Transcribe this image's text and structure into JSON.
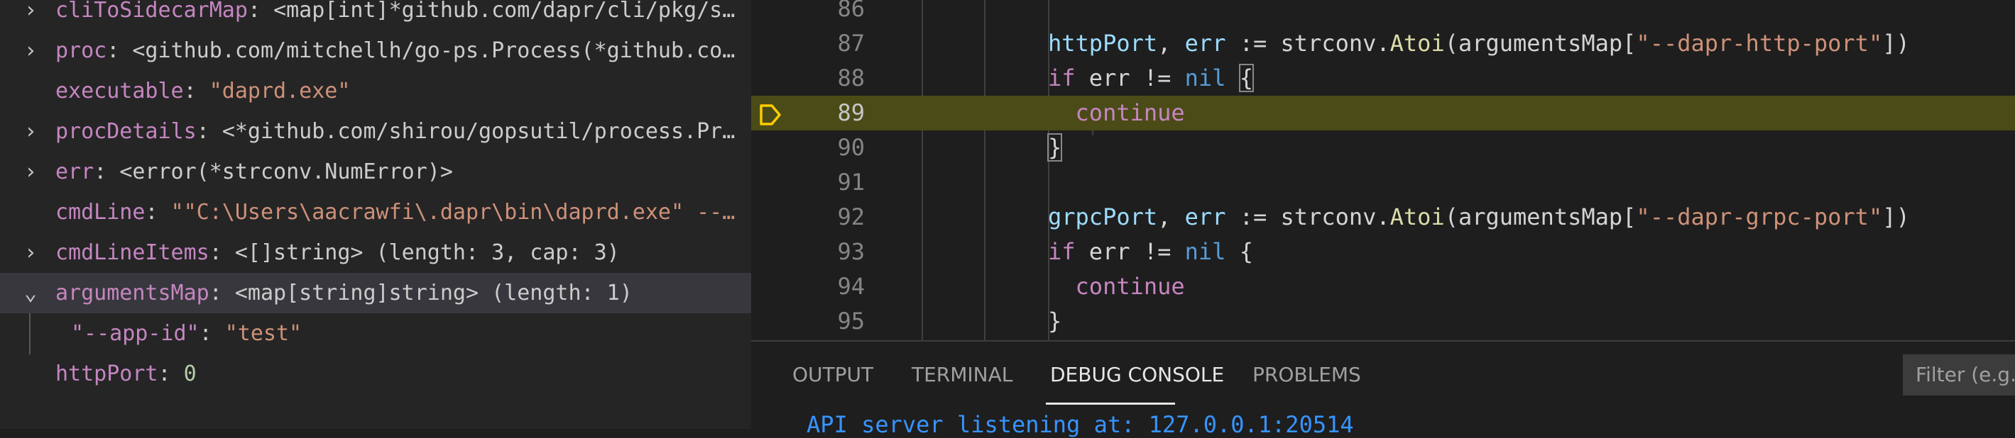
{
  "variables": [
    {
      "chevron": "›",
      "name": "cliToSidecarMap",
      "value": "<map[int]*github.com/dapr/cli/pkg/s…",
      "vtype": "val"
    },
    {
      "chevron": "›",
      "name": "proc",
      "value": "<github.com/mitchellh/go-ps.Process(*github.co…",
      "vtype": "val"
    },
    {
      "chevron": "",
      "name": "executable",
      "value": "\"daprd.exe\"",
      "vtype": "str"
    },
    {
      "chevron": "›",
      "name": "procDetails",
      "value": "<*github.com/shirou/gopsutil/process.Pr…",
      "vtype": "val"
    },
    {
      "chevron": "›",
      "name": "err",
      "value": "<error(*strconv.NumError)>",
      "vtype": "val"
    },
    {
      "chevron": "",
      "name": "cmdLine",
      "value": "\"\"C:\\Users\\aacrawfi\\.dapr\\bin\\daprd.exe\" --…",
      "vtype": "str"
    },
    {
      "chevron": "›",
      "name": "cmdLineItems",
      "value": "<[]string> (length: 3, cap: 3)",
      "vtype": "val"
    },
    {
      "chevron": "⌄",
      "name": "argumentsMap",
      "value": "<map[string]string> (length: 1)",
      "vtype": "val"
    },
    {
      "chevron": "",
      "name": "\"--app-id\"",
      "value": "\"test\"",
      "vtype": "str"
    },
    {
      "chevron": "",
      "name": "httpPort",
      "value": "0",
      "vtype": "num"
    }
  ],
  "editor": {
    "current_line": "89",
    "lines": [
      {
        "num": "86",
        "tokens": []
      },
      {
        "num": "87",
        "tokens": [
          [
            "var",
            "httpPort"
          ],
          [
            "op",
            ", "
          ],
          [
            "var",
            "err"
          ],
          [
            "op",
            " := strconv."
          ],
          [
            "fn",
            "Atoi"
          ],
          [
            "op",
            "(argumentsMap["
          ],
          [
            "str",
            "\"--dapr-http-port\""
          ],
          [
            "op",
            "])"
          ]
        ]
      },
      {
        "num": "88",
        "tokens": [
          [
            "kw",
            "if"
          ],
          [
            "op",
            " err != "
          ],
          [
            "kw2",
            "nil"
          ],
          [
            "op",
            " {"
          ]
        ]
      },
      {
        "num": "89",
        "tokens": [
          [
            "op",
            "  "
          ],
          [
            "kw",
            "continue"
          ]
        ]
      },
      {
        "num": "90",
        "tokens": [
          [
            "op",
            "}"
          ]
        ]
      },
      {
        "num": "91",
        "tokens": []
      },
      {
        "num": "92",
        "tokens": [
          [
            "var",
            "grpcPort"
          ],
          [
            "op",
            ", "
          ],
          [
            "var",
            "err"
          ],
          [
            "op",
            " := strconv."
          ],
          [
            "fn",
            "Atoi"
          ],
          [
            "op",
            "(argumentsMap["
          ],
          [
            "str",
            "\"--dapr-grpc-port\""
          ],
          [
            "op",
            "])"
          ]
        ]
      },
      {
        "num": "93",
        "tokens": [
          [
            "kw",
            "if"
          ],
          [
            "op",
            " err != "
          ],
          [
            "kw2",
            "nil"
          ],
          [
            "op",
            " {"
          ]
        ]
      },
      {
        "num": "94",
        "tokens": [
          [
            "op",
            "  "
          ],
          [
            "kw",
            "continue"
          ]
        ]
      },
      {
        "num": "95",
        "tokens": [
          [
            "op",
            "}"
          ]
        ]
      }
    ]
  },
  "panel": {
    "tabs": [
      "OUTPUT",
      "TERMINAL",
      "DEBUG CONSOLE",
      "PROBLEMS"
    ],
    "active_tab": "DEBUG CONSOLE",
    "filter_placeholder": "Filter (e.g.",
    "console_output": "API server listening at: 127.0.0.1:20514"
  },
  "colors": {
    "current_line_highlight": "#4b4b18",
    "breakpoint_arrow": "#ffcc00",
    "selected_row": "#37373d"
  }
}
